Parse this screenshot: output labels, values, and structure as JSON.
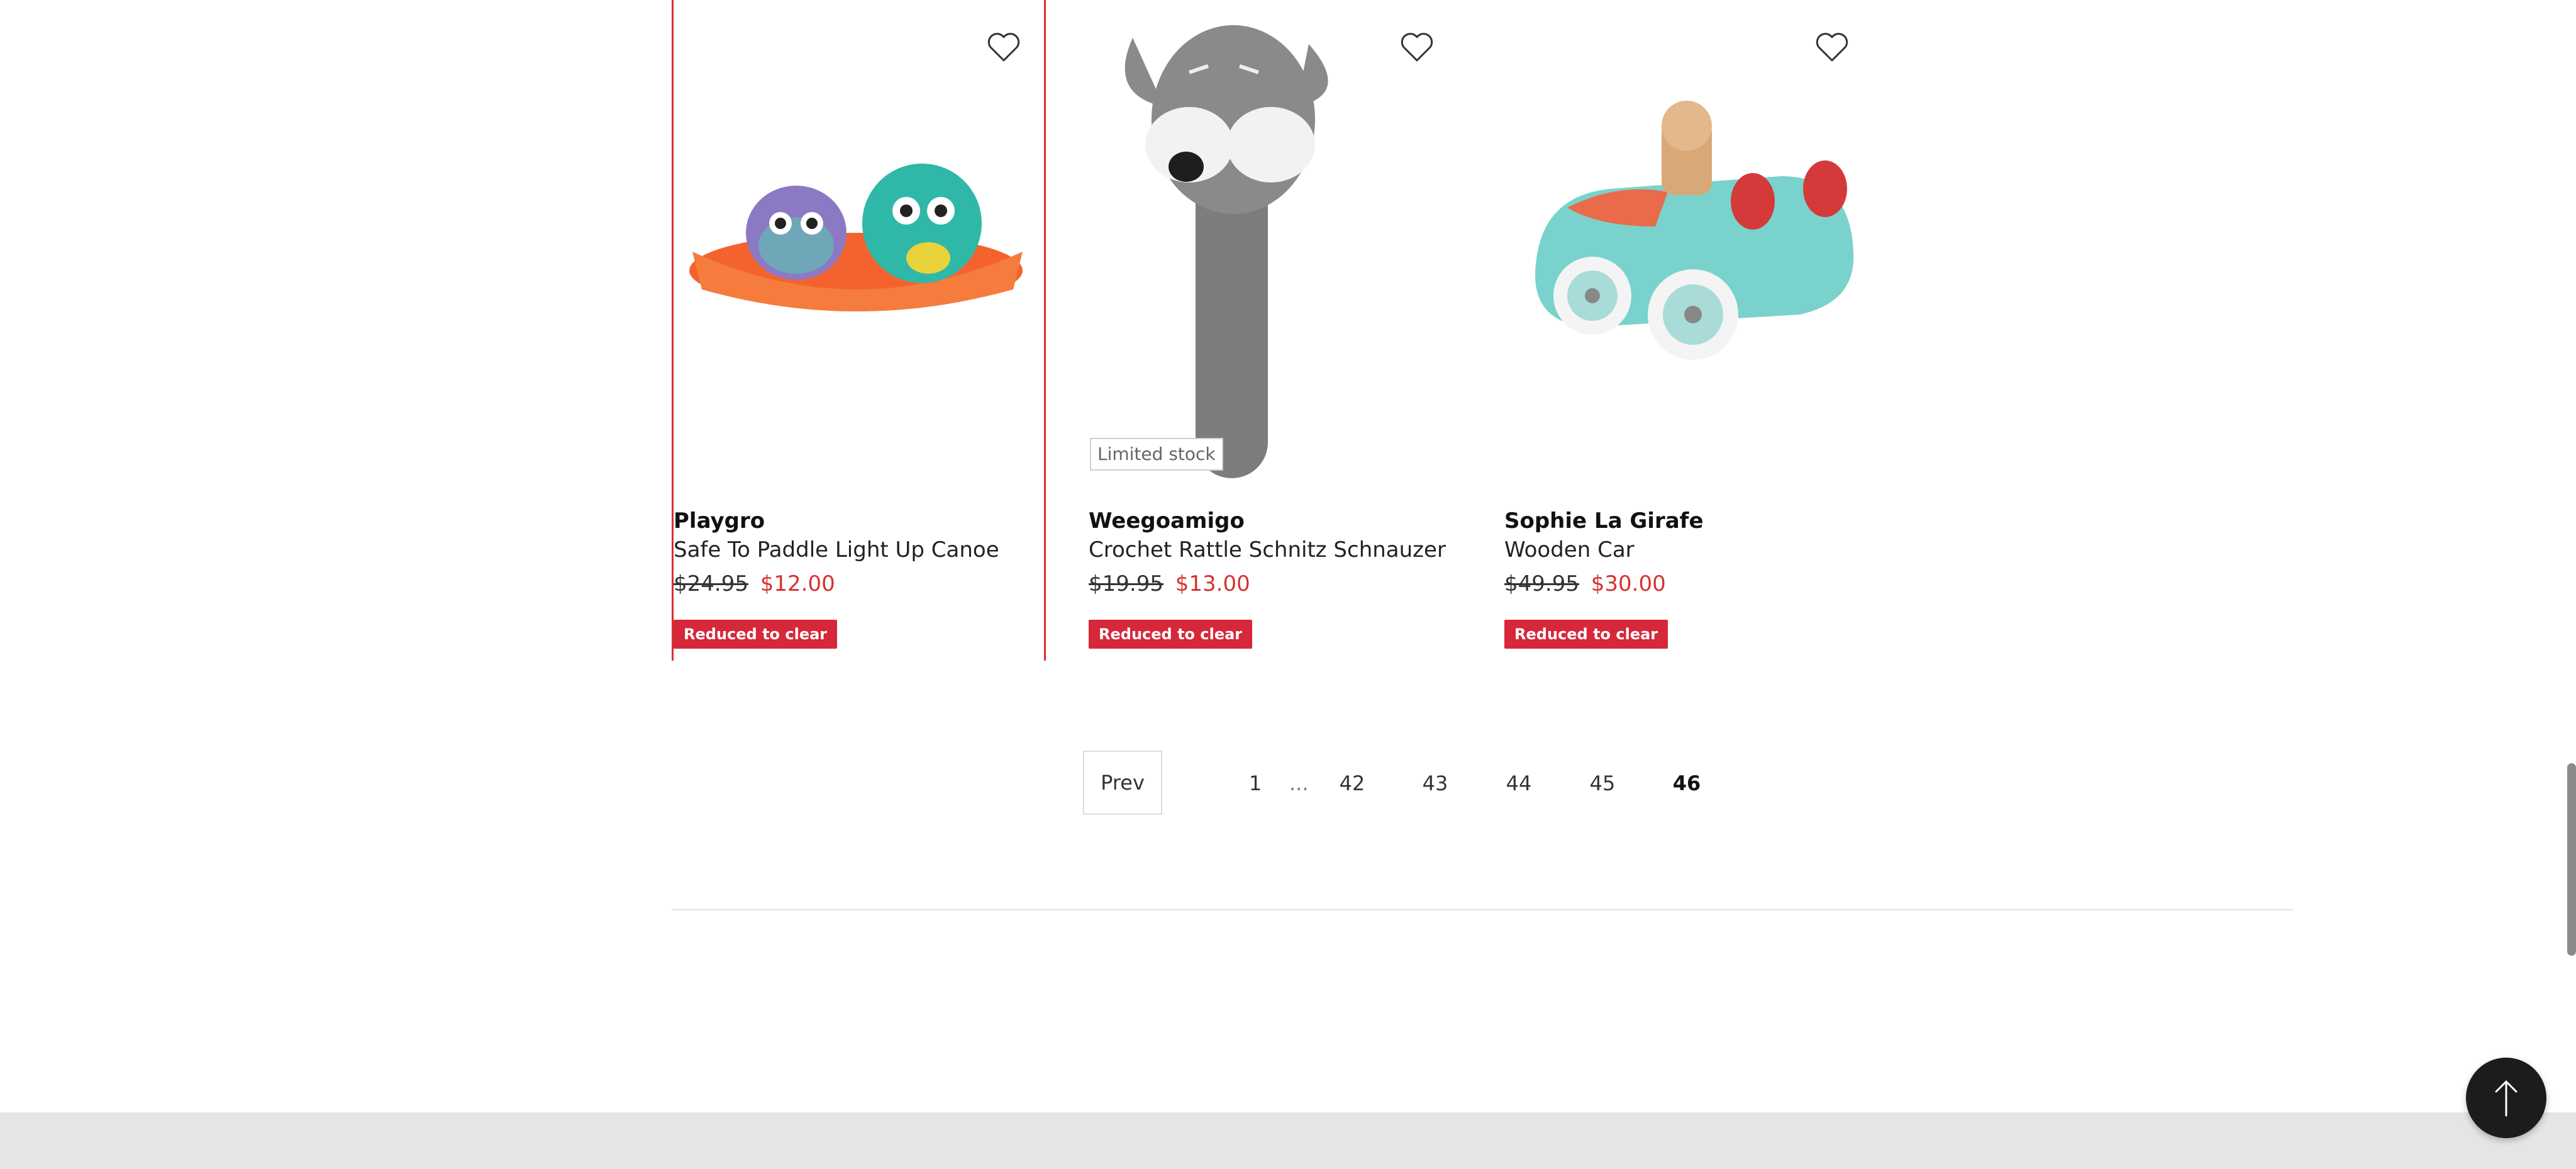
{
  "products": [
    {
      "brand": "Playgro",
      "name": "Safe To Paddle Light Up Canoe",
      "old_price": "$24.95",
      "new_price": "$12.00",
      "badge": "Reduced to clear"
    },
    {
      "brand": "Weegoamigo",
      "name": "Crochet Rattle Schnitz Schnauzer",
      "old_price": "$19.95",
      "new_price": "$13.00",
      "badge": "Reduced to clear",
      "stock_label": "Limited stock"
    },
    {
      "brand": "Sophie La Girafe",
      "name": "Wooden Car",
      "old_price": "$49.95",
      "new_price": "$30.00",
      "badge": "Reduced to clear"
    }
  ],
  "pagination": {
    "prev_label": "Prev",
    "first": "1",
    "ellipsis": "...",
    "pages": [
      "42",
      "43",
      "44",
      "45",
      "46"
    ],
    "current": "46"
  },
  "icons": {
    "favorite": "heart-outline-icon",
    "back_to_top": "arrow-up-icon"
  },
  "colors": {
    "sale_red": "#d6322f",
    "badge_red": "#d6283a",
    "footer_gray": "#e5e5e5",
    "scroll_top_bg": "#1c1c1c"
  }
}
